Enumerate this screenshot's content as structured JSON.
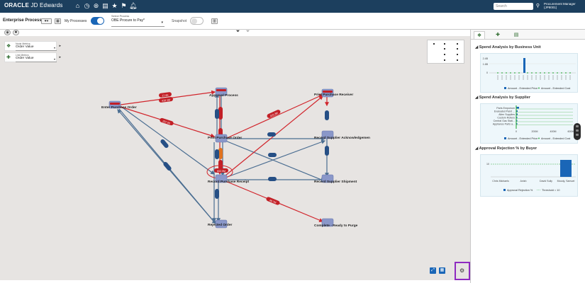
{
  "header": {
    "brand": "ORACLE",
    "product": "JD Edwards",
    "search_placeholder": "Search",
    "user_line1": "Procurement Manager",
    "user_line2": "(JP8001)"
  },
  "toolbar": {
    "title": "Enterprise Process",
    "my_processes_label": "My Processes",
    "select_process_label": "Select Process",
    "select_process_value": "OBE Procure to Pay*",
    "snapshot_label": "Snapshot"
  },
  "metrics": {
    "node_label": "Node Metrics",
    "node_value": "Order Value",
    "link_label": "Link Metrics",
    "link_value": "Order Value"
  },
  "nodes": {
    "enter": "Enter Purchase Order",
    "approval": "Approval Process",
    "print": "Print Purchase Order",
    "receipt": "Record Purchase Receipt",
    "rejected": "Rejected Order",
    "print_receiver": "Print Purchase Receiver",
    "ack": "Record Supplier Acknowledgemen",
    "shipment": "Record Supplier Shipment",
    "complete": "Complete - Ready to Purge"
  },
  "edge_labels": {
    "e1": "17.6K",
    "e2": "416.1M",
    "e3": "237.5K",
    "e4": "416.3M",
    "e5": "602.9M",
    "e6": "48.7M"
  },
  "right_panel": {
    "section1": "Spend Analysis by Business Unit",
    "section2": "Spend Analysis by Supplier",
    "section3": "Approval Rejection % by Buyer",
    "s1_y_ticks": [
      "2.4B",
      "1.6B",
      "0"
    ],
    "s1_legend": [
      "Amount - Extended Price",
      "Amount - Extended Cost"
    ],
    "s2_suppliers": [
      "Parts Emporium",
      "Evaluated Paint ...",
      "Allen Supplies",
      "Custom Rollers",
      "Central Gas Stati...",
      "Appliance Parts a..."
    ],
    "s2_x_ticks": [
      "0",
      "200M",
      "400M",
      "600M"
    ],
    "s2_legend": [
      "Amount - Extended Price",
      "Amount - Extended Cost"
    ],
    "s3_y_tick": "10",
    "s3_buyers": [
      "Chris Michaels",
      "Anish",
      "David Sully",
      "Moody, Samuel"
    ],
    "s3_legend": [
      "Approval Rejection %",
      "Threshold = 10"
    ]
  },
  "colors": {
    "brand_bar": "#1c3f5e",
    "accent": "#1a66b7",
    "edge_red": "#d1252c",
    "edge_blue": "#4a6d91",
    "node": "#8a97c9",
    "gear_highlight": "#8e2ac0"
  }
}
